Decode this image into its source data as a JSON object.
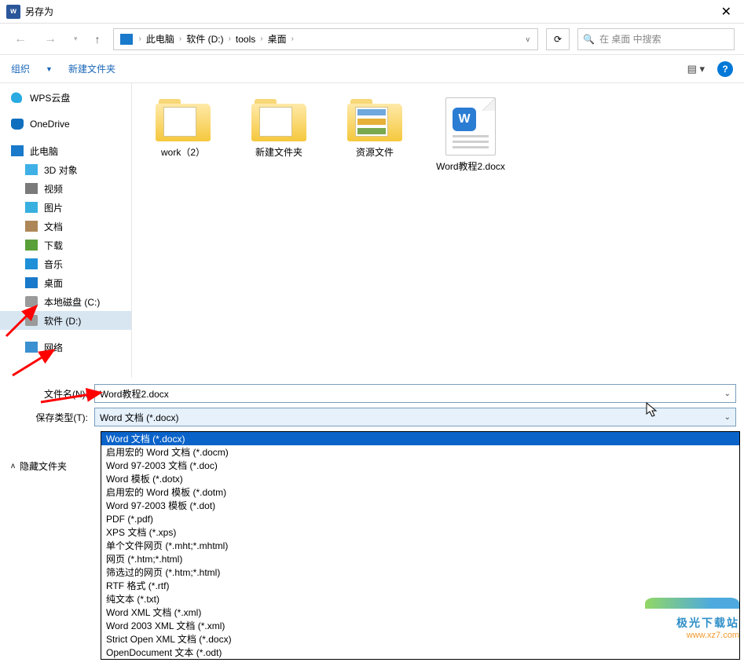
{
  "title": "另存为",
  "breadcrumb": [
    "此电脑",
    "软件 (D:)",
    "tools",
    "桌面"
  ],
  "search": {
    "placeholder": "在 桌面 中搜索"
  },
  "toolbar": {
    "organize": "组织",
    "new_folder": "新建文件夹"
  },
  "sidebar": {
    "wps": "WPS云盘",
    "onedrive": "OneDrive",
    "this_pc": "此电脑",
    "objects3d": "3D 对象",
    "videos": "视频",
    "pictures": "图片",
    "documents": "文档",
    "downloads": "下载",
    "music": "音乐",
    "desktop": "桌面",
    "disk_c": "本地磁盘 (C:)",
    "disk_d": "软件 (D:)",
    "network": "网络"
  },
  "files": {
    "f1": "work（2）",
    "f2": "新建文件夹",
    "f3": "资源文件",
    "f4": "Word教程2.docx"
  },
  "form": {
    "filename_label": "文件名(N):",
    "filename_value": "Word教程2.docx",
    "type_label": "保存类型(T):",
    "type_value": "Word 文档 (*.docx)"
  },
  "type_options": [
    "Word 文档 (*.docx)",
    "启用宏的 Word 文档 (*.docm)",
    "Word 97-2003 文档 (*.doc)",
    "Word 模板 (*.dotx)",
    "启用宏的 Word 模板 (*.dotm)",
    "Word 97-2003 模板 (*.dot)",
    "PDF (*.pdf)",
    "XPS 文档 (*.xps)",
    "单个文件网页 (*.mht;*.mhtml)",
    "网页 (*.htm;*.html)",
    "筛选过的网页 (*.htm;*.html)",
    "RTF 格式 (*.rtf)",
    "纯文本 (*.txt)",
    "Word XML 文档 (*.xml)",
    "Word 2003 XML 文档 (*.xml)",
    "Strict Open XML 文档 (*.docx)",
    "OpenDocument 文本 (*.odt)"
  ],
  "hide_folders": "隐藏文件夹",
  "watermark": {
    "line1": "极光下载站",
    "line2": "www.xz7.com"
  }
}
